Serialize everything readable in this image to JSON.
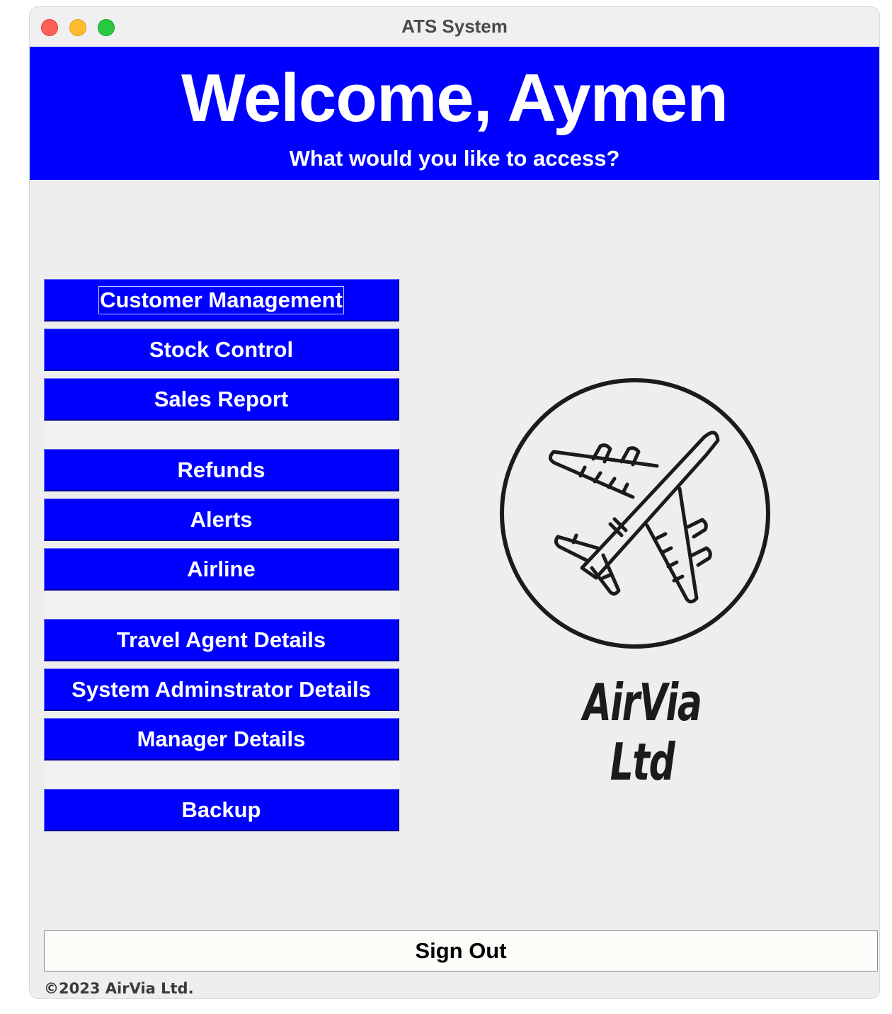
{
  "window": {
    "title": "ATS System"
  },
  "header": {
    "welcome": "Welcome, Aymen",
    "subtitle": "What would you like to access?",
    "background": "#0000ff"
  },
  "menu": {
    "items": [
      {
        "label": "Customer Management",
        "focused": true
      },
      {
        "label": "Stock Control"
      },
      {
        "label": "Sales Report"
      },
      {
        "label": "Refunds"
      },
      {
        "label": "Alerts"
      },
      {
        "label": "Airline"
      },
      {
        "label": "Travel Agent Details"
      },
      {
        "label": "System Adminstrator Details"
      },
      {
        "label": "Manager Details"
      },
      {
        "label": "Backup"
      }
    ]
  },
  "logo": {
    "icon": "airplane-icon",
    "brand": "AirVia Ltd"
  },
  "signout": {
    "label": "Sign Out"
  },
  "footer": {
    "copyright": "©2023 AirVia Ltd."
  }
}
